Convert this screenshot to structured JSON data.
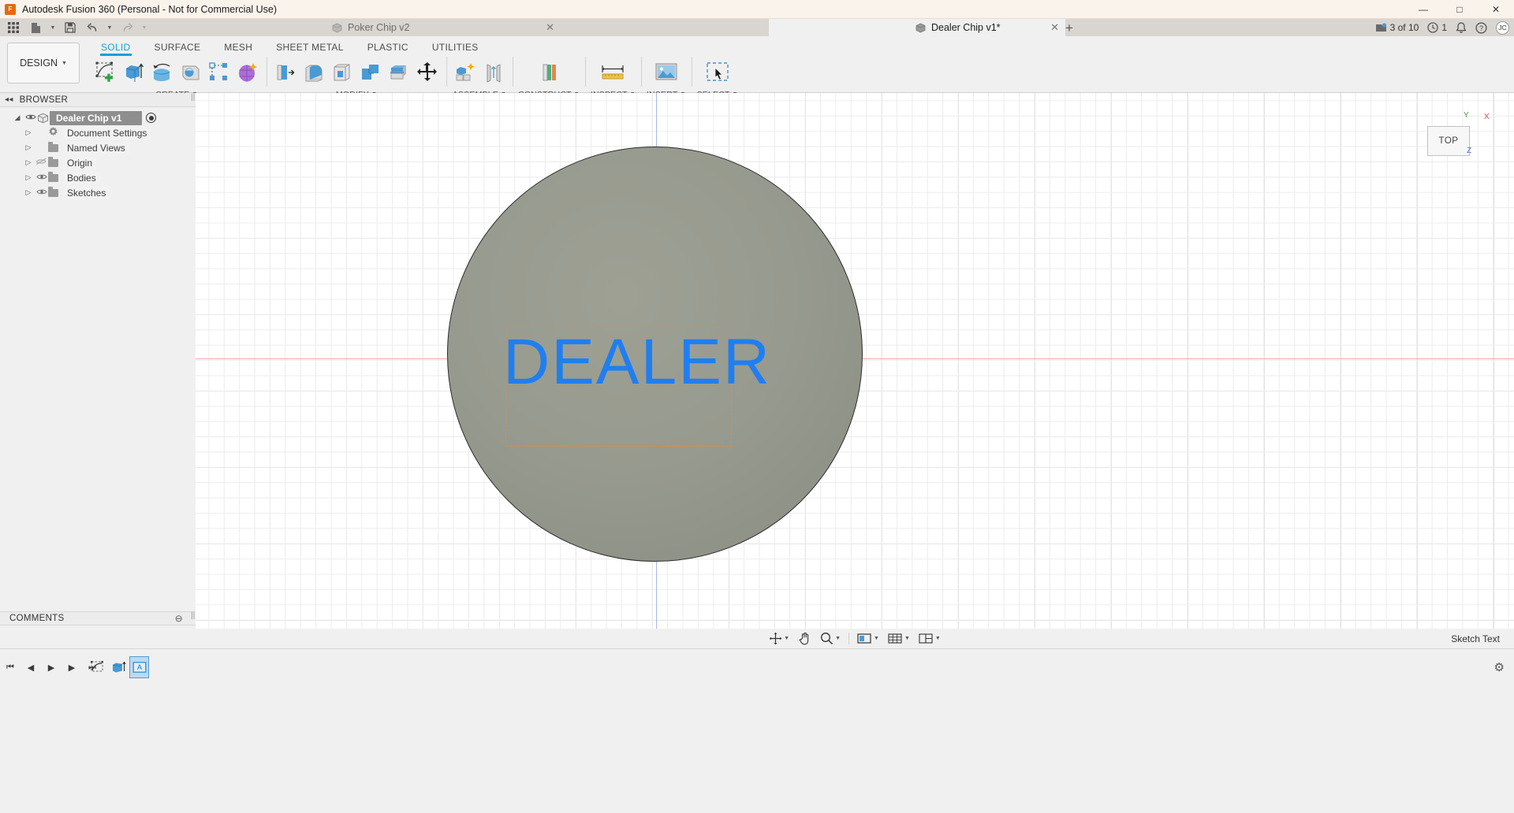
{
  "titlebar": {
    "app_name": "Autodesk Fusion 360 (Personal - Not for Commercial Use)",
    "logo_text": "F",
    "minimize": "—",
    "maximize": "□",
    "close": "✕"
  },
  "quickaccess": {
    "grid_icon": "apps-grid-icon",
    "new_label": "new-document-icon",
    "save_label": "save-icon",
    "undo_label": "undo-icon",
    "redo_label": "redo-icon",
    "caret": "▼"
  },
  "tabs": [
    {
      "label": "Poker Chip v2",
      "active": false,
      "close": "✕"
    },
    {
      "label": "Dealer Chip v1*",
      "active": true,
      "close": "✕"
    }
  ],
  "tab_add": "+",
  "status_right": {
    "jobs": "3 of 10",
    "time": "1",
    "bell": "notifications-icon",
    "help": "help-icon",
    "avatar_initials": "JC"
  },
  "design_button": {
    "label": "DESIGN",
    "caret": "▼"
  },
  "ribbon_tabs": [
    {
      "label": "SOLID",
      "active": true
    },
    {
      "label": "SURFACE",
      "active": false
    },
    {
      "label": "MESH",
      "active": false
    },
    {
      "label": "SHEET METAL",
      "active": false
    },
    {
      "label": "PLASTIC",
      "active": false
    },
    {
      "label": "UTILITIES",
      "active": false
    }
  ],
  "ribbon_groups": [
    {
      "label": "CREATE",
      "caret": "▼"
    },
    {
      "label": "MODIFY",
      "caret": "▼"
    },
    {
      "label": "ASSEMBLE",
      "caret": "▼"
    },
    {
      "label": "CONSTRUCT",
      "caret": "▼"
    },
    {
      "label": "INSPECT",
      "caret": "▼"
    },
    {
      "label": "INSERT",
      "caret": "▼"
    },
    {
      "label": "SELECT",
      "caret": "▼"
    }
  ],
  "browser": {
    "title": "BROWSER",
    "collapse": "◂◂",
    "tree": [
      {
        "label": "Dealer Chip v1",
        "level": 0,
        "arrow": "◢",
        "eye": true,
        "type": "root"
      },
      {
        "label": "Document Settings",
        "level": 1,
        "arrow": "▷",
        "eye": false,
        "type": "gear"
      },
      {
        "label": "Named Views",
        "level": 1,
        "arrow": "▷",
        "eye": false,
        "type": "folder"
      },
      {
        "label": "Origin",
        "level": 1,
        "arrow": "▷",
        "eye": true,
        "hidden": true,
        "type": "folder"
      },
      {
        "label": "Bodies",
        "level": 1,
        "arrow": "▷",
        "eye": true,
        "type": "folder"
      },
      {
        "label": "Sketches",
        "level": 1,
        "arrow": "▷",
        "eye": true,
        "type": "folder"
      }
    ]
  },
  "comments": {
    "title": "COMMENTS",
    "collapse": "⊖"
  },
  "canvas": {
    "sketch_text": "DEALER",
    "body_color": "#979a8e",
    "text_color": "#1f7ff0",
    "sketch_box_color": "#e08c3c"
  },
  "viewcube": {
    "face_label": "TOP",
    "axis_x": "X",
    "axis_y": "Y",
    "axis_z": "Z"
  },
  "navbar": {
    "buttons": [
      {
        "name": "orbit-icon",
        "caret": "▼"
      },
      {
        "name": "pan-icon",
        "caret": ""
      },
      {
        "name": "zoom-icon",
        "caret": "▼"
      },
      {
        "name": "display-settings-icon",
        "caret": "▼"
      },
      {
        "name": "grid-snaps-icon",
        "caret": "▼"
      },
      {
        "name": "viewports-icon",
        "caret": "▼"
      }
    ],
    "status_label": "Sketch Text"
  },
  "timeline": {
    "first": "⏮",
    "prev": "◀",
    "play": "▶",
    "next": "▶",
    "last": "⏭",
    "items": [
      {
        "name": "sketch-feature-icon",
        "selected": false
      },
      {
        "name": "extrude-feature-icon",
        "selected": false
      },
      {
        "name": "sketch-text-feature-icon",
        "selected": true
      }
    ],
    "settings": "⚙"
  }
}
